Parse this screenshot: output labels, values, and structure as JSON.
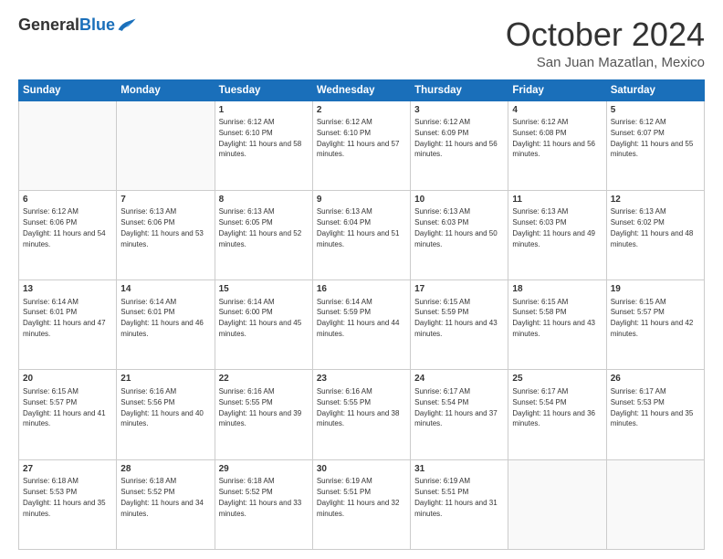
{
  "header": {
    "logo_general": "General",
    "logo_blue": "Blue",
    "month_title": "October 2024",
    "location": "San Juan Mazatlan, Mexico"
  },
  "days_of_week": [
    "Sunday",
    "Monday",
    "Tuesday",
    "Wednesday",
    "Thursday",
    "Friday",
    "Saturday"
  ],
  "weeks": [
    [
      {
        "day": "",
        "info": ""
      },
      {
        "day": "",
        "info": ""
      },
      {
        "day": "1",
        "info": "Sunrise: 6:12 AM\nSunset: 6:10 PM\nDaylight: 11 hours and 58 minutes."
      },
      {
        "day": "2",
        "info": "Sunrise: 6:12 AM\nSunset: 6:10 PM\nDaylight: 11 hours and 57 minutes."
      },
      {
        "day": "3",
        "info": "Sunrise: 6:12 AM\nSunset: 6:09 PM\nDaylight: 11 hours and 56 minutes."
      },
      {
        "day": "4",
        "info": "Sunrise: 6:12 AM\nSunset: 6:08 PM\nDaylight: 11 hours and 56 minutes."
      },
      {
        "day": "5",
        "info": "Sunrise: 6:12 AM\nSunset: 6:07 PM\nDaylight: 11 hours and 55 minutes."
      }
    ],
    [
      {
        "day": "6",
        "info": "Sunrise: 6:12 AM\nSunset: 6:06 PM\nDaylight: 11 hours and 54 minutes."
      },
      {
        "day": "7",
        "info": "Sunrise: 6:13 AM\nSunset: 6:06 PM\nDaylight: 11 hours and 53 minutes."
      },
      {
        "day": "8",
        "info": "Sunrise: 6:13 AM\nSunset: 6:05 PM\nDaylight: 11 hours and 52 minutes."
      },
      {
        "day": "9",
        "info": "Sunrise: 6:13 AM\nSunset: 6:04 PM\nDaylight: 11 hours and 51 minutes."
      },
      {
        "day": "10",
        "info": "Sunrise: 6:13 AM\nSunset: 6:03 PM\nDaylight: 11 hours and 50 minutes."
      },
      {
        "day": "11",
        "info": "Sunrise: 6:13 AM\nSunset: 6:03 PM\nDaylight: 11 hours and 49 minutes."
      },
      {
        "day": "12",
        "info": "Sunrise: 6:13 AM\nSunset: 6:02 PM\nDaylight: 11 hours and 48 minutes."
      }
    ],
    [
      {
        "day": "13",
        "info": "Sunrise: 6:14 AM\nSunset: 6:01 PM\nDaylight: 11 hours and 47 minutes."
      },
      {
        "day": "14",
        "info": "Sunrise: 6:14 AM\nSunset: 6:01 PM\nDaylight: 11 hours and 46 minutes."
      },
      {
        "day": "15",
        "info": "Sunrise: 6:14 AM\nSunset: 6:00 PM\nDaylight: 11 hours and 45 minutes."
      },
      {
        "day": "16",
        "info": "Sunrise: 6:14 AM\nSunset: 5:59 PM\nDaylight: 11 hours and 44 minutes."
      },
      {
        "day": "17",
        "info": "Sunrise: 6:15 AM\nSunset: 5:59 PM\nDaylight: 11 hours and 43 minutes."
      },
      {
        "day": "18",
        "info": "Sunrise: 6:15 AM\nSunset: 5:58 PM\nDaylight: 11 hours and 43 minutes."
      },
      {
        "day": "19",
        "info": "Sunrise: 6:15 AM\nSunset: 5:57 PM\nDaylight: 11 hours and 42 minutes."
      }
    ],
    [
      {
        "day": "20",
        "info": "Sunrise: 6:15 AM\nSunset: 5:57 PM\nDaylight: 11 hours and 41 minutes."
      },
      {
        "day": "21",
        "info": "Sunrise: 6:16 AM\nSunset: 5:56 PM\nDaylight: 11 hours and 40 minutes."
      },
      {
        "day": "22",
        "info": "Sunrise: 6:16 AM\nSunset: 5:55 PM\nDaylight: 11 hours and 39 minutes."
      },
      {
        "day": "23",
        "info": "Sunrise: 6:16 AM\nSunset: 5:55 PM\nDaylight: 11 hours and 38 minutes."
      },
      {
        "day": "24",
        "info": "Sunrise: 6:17 AM\nSunset: 5:54 PM\nDaylight: 11 hours and 37 minutes."
      },
      {
        "day": "25",
        "info": "Sunrise: 6:17 AM\nSunset: 5:54 PM\nDaylight: 11 hours and 36 minutes."
      },
      {
        "day": "26",
        "info": "Sunrise: 6:17 AM\nSunset: 5:53 PM\nDaylight: 11 hours and 35 minutes."
      }
    ],
    [
      {
        "day": "27",
        "info": "Sunrise: 6:18 AM\nSunset: 5:53 PM\nDaylight: 11 hours and 35 minutes."
      },
      {
        "day": "28",
        "info": "Sunrise: 6:18 AM\nSunset: 5:52 PM\nDaylight: 11 hours and 34 minutes."
      },
      {
        "day": "29",
        "info": "Sunrise: 6:18 AM\nSunset: 5:52 PM\nDaylight: 11 hours and 33 minutes."
      },
      {
        "day": "30",
        "info": "Sunrise: 6:19 AM\nSunset: 5:51 PM\nDaylight: 11 hours and 32 minutes."
      },
      {
        "day": "31",
        "info": "Sunrise: 6:19 AM\nSunset: 5:51 PM\nDaylight: 11 hours and 31 minutes."
      },
      {
        "day": "",
        "info": ""
      },
      {
        "day": "",
        "info": ""
      }
    ]
  ]
}
